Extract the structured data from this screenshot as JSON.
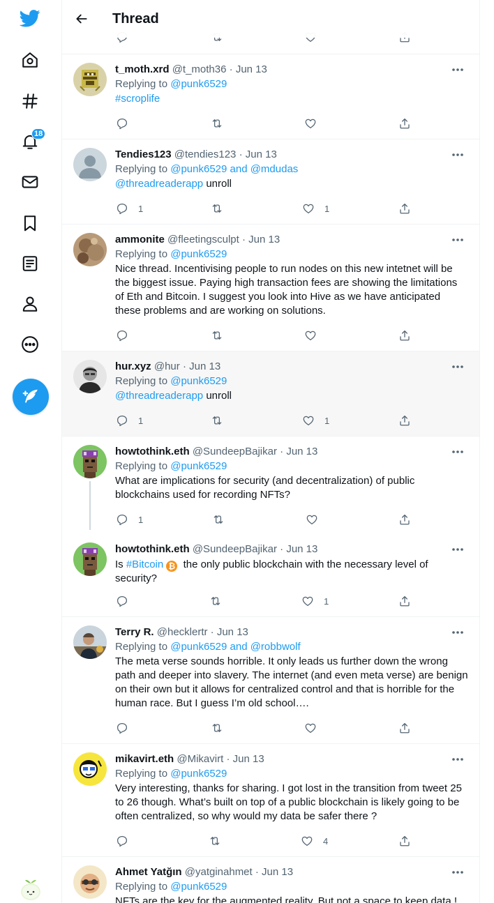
{
  "header": {
    "title": "Thread"
  },
  "sidebar": {
    "notification_badge": "18"
  },
  "tweets": [
    {
      "name": "t_moth.xrd",
      "handle": "@t_moth36",
      "date": "Jun 13",
      "replying_prefix": "Replying to",
      "replying_to": "@punk6529",
      "hashtag": "#scroplife",
      "reply_count": "",
      "like_count": ""
    },
    {
      "name": "Tendies123",
      "handle": "@tendies123",
      "date": "Jun 13",
      "replying_prefix": "Replying to",
      "replying_to": "@punk6529 and @mdudas",
      "mention": "@threadreaderapp",
      "text_after": "unroll",
      "reply_count": "1",
      "like_count": "1"
    },
    {
      "name": "ammonite",
      "handle": "@fleetingsculpt",
      "date": "Jun 13",
      "replying_prefix": "Replying to",
      "replying_to": "@punk6529",
      "text": "Nice thread. Incentivising people to run nodes on this new intetnet will be the biggest issue. Paying high transaction fees are showing the limitations of Eth and Bitcoin. I suggest you look into Hive as we have anticipated these problems and are working on solutions.",
      "reply_count": "",
      "like_count": ""
    },
    {
      "name": "hur.xyz",
      "handle": "@hur",
      "date": "Jun 13",
      "replying_prefix": "Replying to",
      "replying_to": "@punk6529",
      "mention": "@threadreaderapp",
      "text_after": "unroll",
      "reply_count": "1",
      "like_count": "1"
    },
    {
      "name": "howtothink.eth",
      "handle": "@SundeepBajikar",
      "date": "Jun 13",
      "replying_prefix": "Replying to",
      "replying_to": "@punk6529",
      "text": "What are implications for security (and decentralization) of public blockchains used for recording NFTs?",
      "reply_count": "1",
      "like_count": ""
    },
    {
      "name": "howtothink.eth",
      "handle": "@SundeepBajikar",
      "date": "Jun 13",
      "text_prefix": "Is",
      "hashtag": "#Bitcoin",
      "text_line1": "the only public blockchain with the necessary level of",
      "text_line2": "security?",
      "reply_count": "",
      "like_count": "1"
    },
    {
      "name": "Terry R.",
      "handle": "@hecklertr",
      "date": "Jun 13",
      "replying_prefix": "Replying to",
      "replying_to": "@punk6529 and @robbwolf",
      "text": "The meta verse sounds horrible. It only leads us further down the wrong path and deeper into slavery. The internet (and even meta verse) are benign on their own but it allows for centralized control and that is horrible for the human race. But I guess I’m old school….",
      "reply_count": "",
      "like_count": ""
    },
    {
      "name": "mikavirt.eth",
      "handle": "@Mikavirt",
      "date": "Jun 13",
      "replying_prefix": "Replying to",
      "replying_to": "@punk6529",
      "text": "Very interesting, thanks for sharing. I got lost in the transition from tweet 25 to 26 though. What’s built on top of a public blockchain is likely going to be often centralized, so why would my data be safer there ?",
      "reply_count": "",
      "like_count": "4"
    },
    {
      "name": "Ahmet Yatğın",
      "handle": "@yatginahmet",
      "date": "Jun 13",
      "replying_prefix": "Replying to",
      "replying_to": "@punk6529",
      "text": "NFTs are the key for the augmented reality. But not a space to keep data !",
      "reply_count": "",
      "like_count": ""
    }
  ],
  "colors": {
    "accent": "#1d9bf0",
    "text": "#0f1419",
    "secondary": "#536471",
    "bitcoin": "#f7931a"
  },
  "icons": {
    "logo": "bird-icon",
    "home": "home-icon",
    "explore": "hashtag-icon",
    "notifications": "bell-icon",
    "messages": "mail-icon",
    "bookmarks": "bookmark-icon",
    "lists": "list-icon",
    "profile": "profile-icon",
    "more": "more-circle-icon",
    "compose": "feather-icon"
  }
}
